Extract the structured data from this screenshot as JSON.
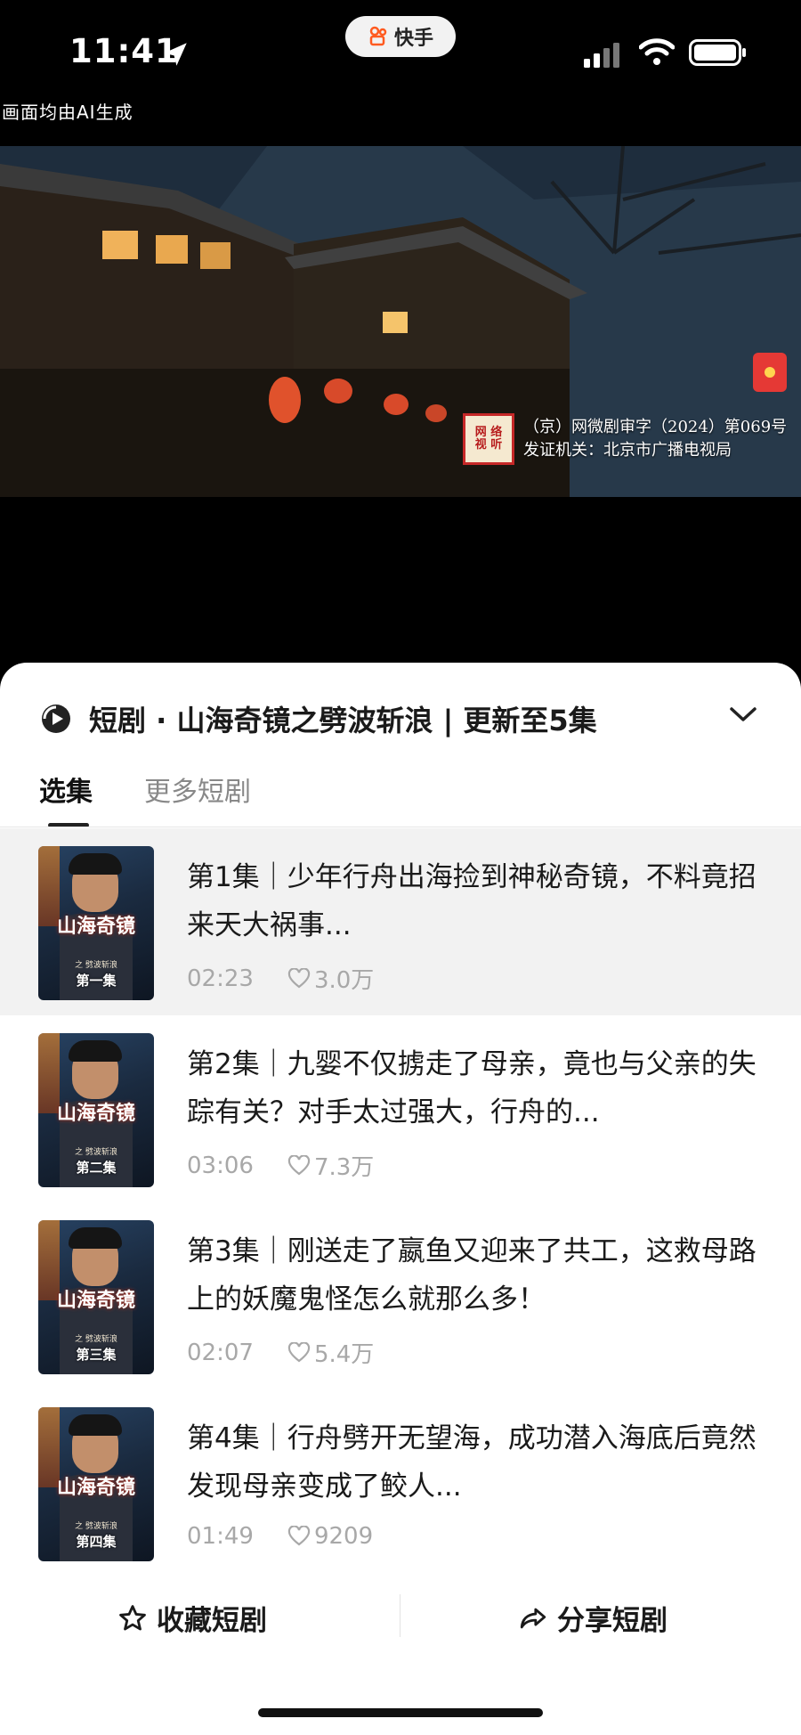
{
  "status_bar": {
    "time": "11:41",
    "app_name": "快手"
  },
  "ai_note": "画面均由AI生成",
  "video": {
    "seal_text": "网络视听",
    "license_line1": "（京）网微剧审字（2024）第069号",
    "license_line2": "发证机关：北京市广播电视局"
  },
  "sheet": {
    "header_title": "短剧 · 山海奇镜之劈波斩浪 | 更新至5集",
    "tabs": [
      {
        "label": "选集",
        "active": true
      },
      {
        "label": "更多短剧",
        "active": false
      }
    ],
    "poster_title": "山海奇镜",
    "poster_sub": "之 劈波斩浪",
    "episodes": [
      {
        "poster_ep": "第一集",
        "text": "第1集｜少年行舟出海捡到神秘奇镜，不料竟招来天大祸事...",
        "duration": "02:23",
        "likes": "3.0万",
        "selected": true
      },
      {
        "poster_ep": "第二集",
        "text": "第2集｜九婴不仅掳走了母亲，竟也与父亲的失踪有关？对手太过强大，行舟的...",
        "duration": "03:06",
        "likes": "7.3万",
        "selected": false
      },
      {
        "poster_ep": "第三集",
        "text": "第3集｜刚送走了嬴鱼又迎来了共工，这救母路上的妖魔鬼怪怎么就那么多！",
        "duration": "02:07",
        "likes": "5.4万",
        "selected": false
      },
      {
        "poster_ep": "第四集",
        "text": "第4集｜行舟劈开无望海，成功潜入海底后竟然发现母亲变成了鲛人...",
        "duration": "01:49",
        "likes": "9209",
        "selected": false
      }
    ],
    "bottom": {
      "favorite_label": "收藏短剧",
      "share_label": "分享短剧"
    }
  }
}
